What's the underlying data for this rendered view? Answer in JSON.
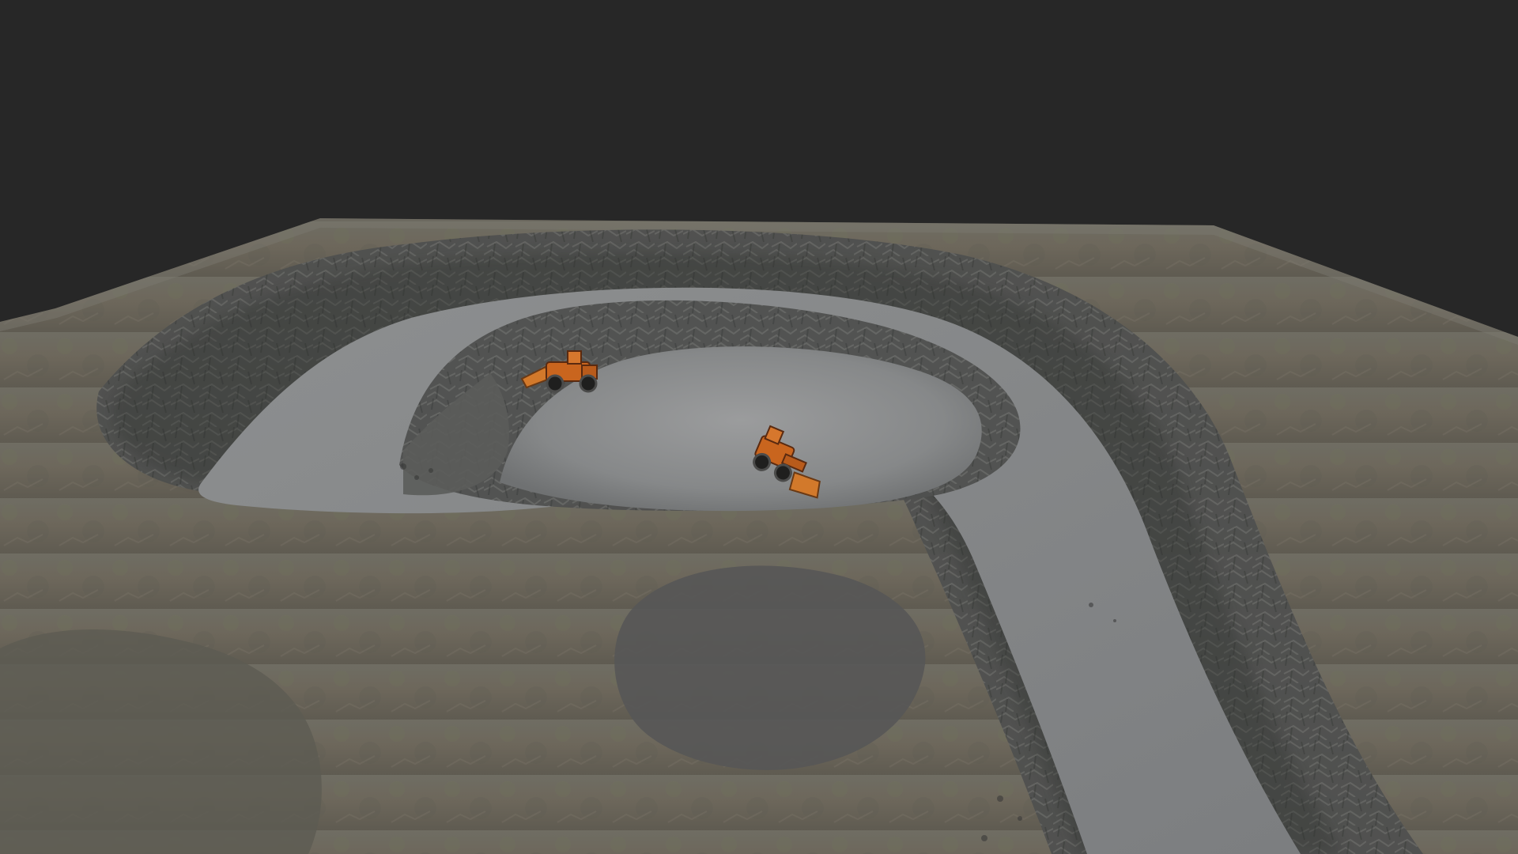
{
  "viewer": {
    "background_color": "#272727"
  },
  "scene": {
    "terrain_color": "#6f6a5f",
    "rock_wall_color": "#4b4c4b",
    "road_color": "#8b8d8f",
    "pit_floor_color": "#7f8183",
    "vehicle_color": "#c7671e",
    "vehicles": [
      "wheel-loader",
      "wheel-loader"
    ]
  }
}
